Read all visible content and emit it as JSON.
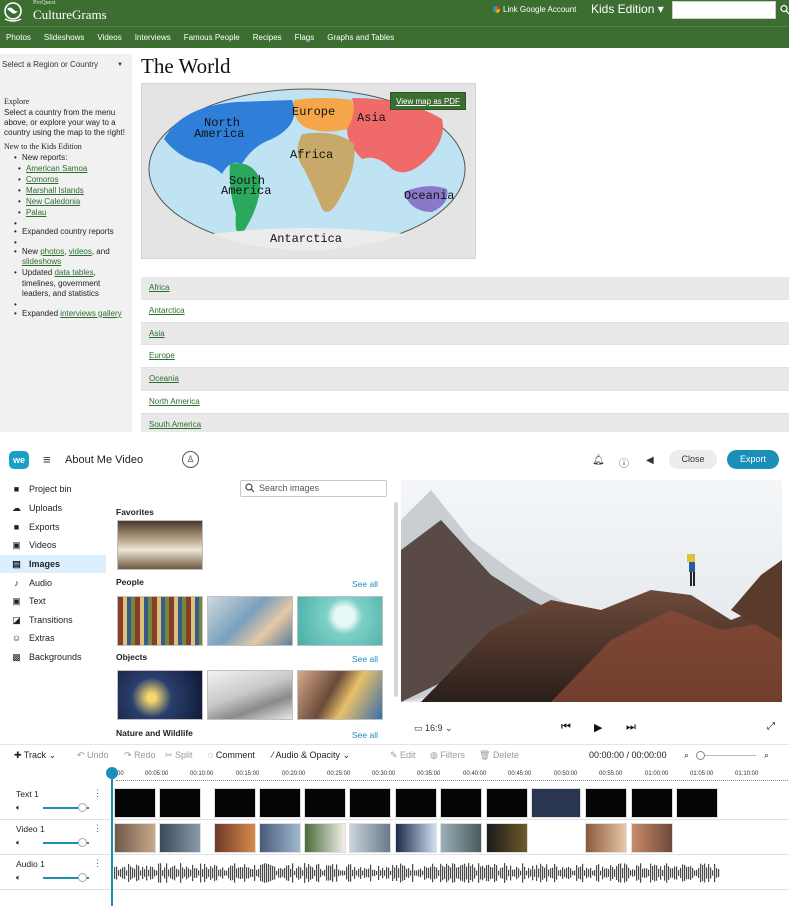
{
  "culturegrams": {
    "brand_small": "ProQuest",
    "brand": "CultureGrams",
    "google_link": "Link Google Account",
    "edition": "Kids Edition ▾",
    "nav": [
      "Photos",
      "Slideshows",
      "Videos",
      "Interviews",
      "Famous People",
      "Recipes",
      "Flags",
      "Graphs and Tables"
    ],
    "select_placeholder": "Select a Region or Country",
    "page_title": "The World",
    "map_button": "View map as PDF",
    "map_labels": {
      "north_america": [
        "North",
        "America"
      ],
      "south_america": [
        "South",
        "America"
      ],
      "europe": "Europe",
      "asia": "Asia",
      "africa": "Africa",
      "oceania": "Oceania",
      "antarctica": "Antarctica"
    },
    "explore_title": "Explore",
    "explore_text": "Select a country from the menu above, or explore your way to a country using the map to the right!",
    "new_title": "New to the Kids Edition",
    "new_reports_label": "New reports:",
    "new_reports": [
      "American Samoa",
      "Comoros",
      "Marshall Islands",
      "New Caledonia",
      "Palau"
    ],
    "expanded_reports": "Expanded country reports",
    "new_media": {
      "prefix": "New ",
      "photos": "photos",
      "sep": ", ",
      "videos": "videos",
      "and": ", and ",
      "slideshows": "slideshows"
    },
    "updated": {
      "prefix": "Updated ",
      "link": "data tables",
      "rest": ", timelines, government leaders, and statistics"
    },
    "expanded_interviews": {
      "prefix": "Expanded ",
      "link": "interviews gallery"
    },
    "regions": [
      "Africa",
      "Antarctica",
      "Asia",
      "Europe",
      "Oceania",
      "North America",
      "South America"
    ]
  },
  "wevideo": {
    "logo": "we",
    "project_name": "About Me Video",
    "close": "Close",
    "export": "Export",
    "sidebar": [
      "Project bin",
      "Uploads",
      "Exports",
      "Videos",
      "Images",
      "Audio",
      "Text",
      "Transitions",
      "Extras",
      "Backgrounds"
    ],
    "active_sidebar": "Images",
    "search_placeholder": "Search images",
    "categories": {
      "favorites": "Favorites",
      "people": "People",
      "objects": "Objects",
      "nature": "Nature and Wildlife"
    },
    "see_all": "See all",
    "aspect": "16:9",
    "toolbar": {
      "track": "Track",
      "undo": "Undo",
      "redo": "Redo",
      "split": "Split",
      "comment": "Comment",
      "audio_opacity": "Audio & Opacity",
      "edit": "Edit",
      "filters": "Filters",
      "delete": "Delete",
      "time": "00:00:00 / 00:00:00"
    },
    "ruler": [
      "00",
      "00:05:00",
      "00:10:00",
      "00:15:00",
      "00:20:00",
      "00:25:00",
      "00:30:00",
      "00:35:00",
      "00:40:00",
      "00:45:00",
      "00:50:00",
      "00:55:00",
      "01:00:00",
      "01:05:00",
      "01:10:00"
    ],
    "tracks": [
      "Text 1",
      "Video 1",
      "Audio 1"
    ]
  },
  "colors": {
    "cg_green": "#3c6e31",
    "wv_blue": "#1a8fb8"
  }
}
